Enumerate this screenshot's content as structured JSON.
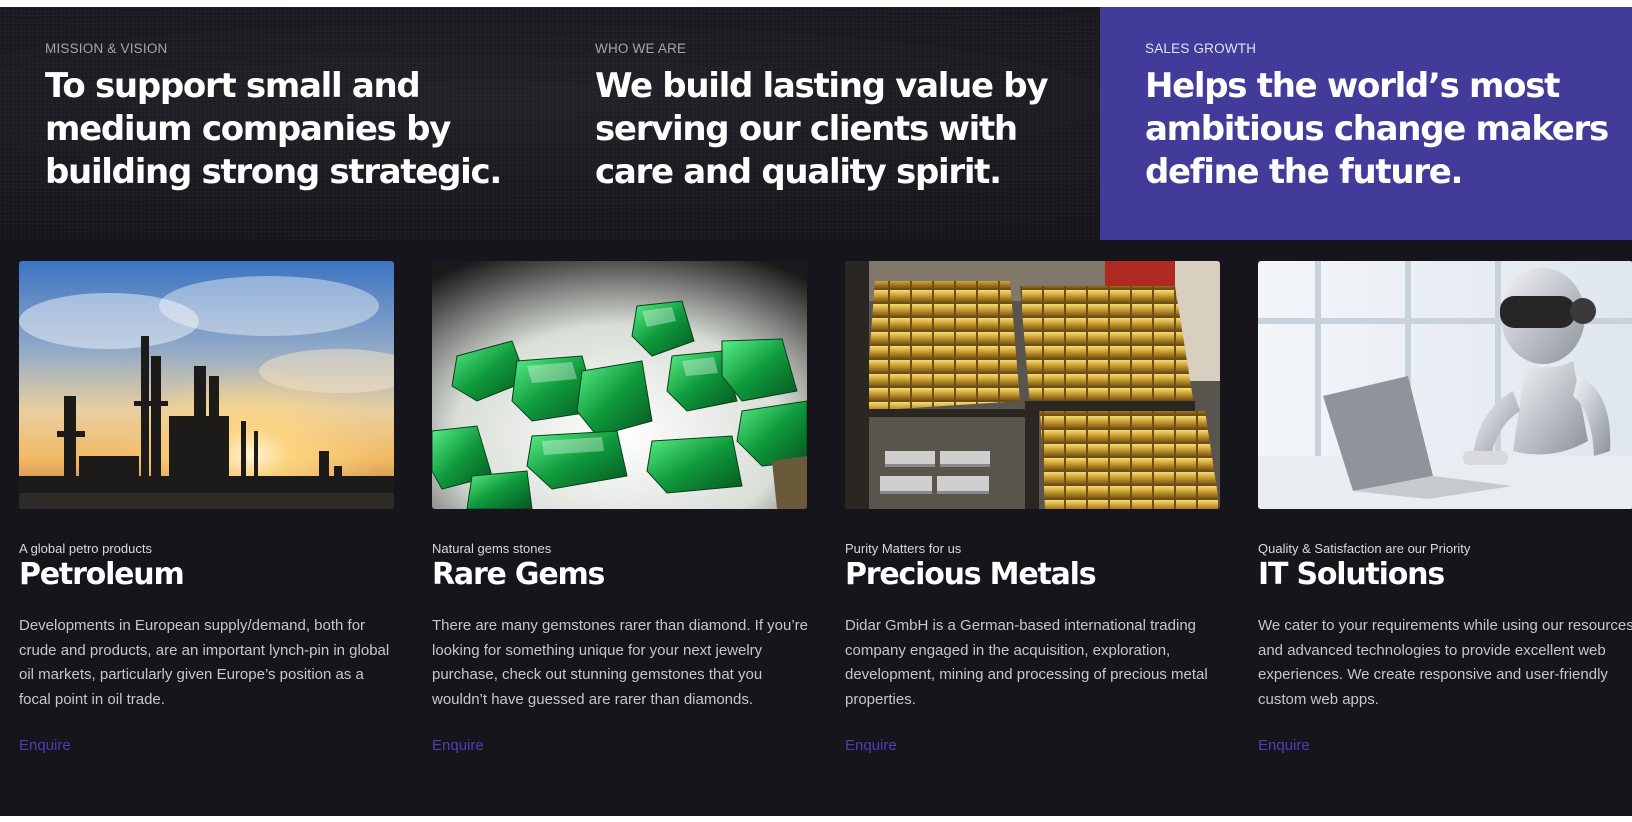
{
  "hero": [
    {
      "eyebrow": "MISSION & VISION",
      "title": "To support small and medium companies by building strong strategic."
    },
    {
      "eyebrow": "WHO WE ARE",
      "title": "We build lasting value by serving our clients with care and quality spirit."
    },
    {
      "eyebrow": "SALES GROWTH",
      "title": "Helps the world’s most ambitious change makers define the future."
    }
  ],
  "cards": [
    {
      "image": "oil-refinery-sunset-photo",
      "tagline": "A global petro products",
      "title": "Petroleum",
      "description": "Developments in European supply/demand, both for crude and products, are an important lynch-pin in global oil markets, particularly given Europe’s position as a focal point in oil trade.",
      "link": "Enquire"
    },
    {
      "image": "green-emerald-crystals-photo",
      "tagline": "Natural gems stones",
      "title": "Rare Gems",
      "description": "There are many gemstones rarer than diamond. If you’re looking for something unique for your next jewelry purchase, check out stunning gemstones that you wouldn’t have guessed are rarer than diamonds.",
      "link": "Enquire"
    },
    {
      "image": "gold-bullion-bars-vault-photo",
      "tagline": "Purity Matters for us",
      "title": "Precious Metals",
      "description": "Didar GmbH is a German-based international trading company engaged in the acquisition, exploration, development, mining and processing of precious metal properties.",
      "link": "Enquire"
    },
    {
      "image": "robot-with-laptop-photo",
      "tagline": "Quality & Satisfaction are our Priority",
      "title": "IT Solutions",
      "description": "We cater to your requirements while using our resources and advanced technologies to provide excellent web experiences. We create responsive and user-friendly custom web apps.",
      "link": "Enquire"
    }
  ],
  "colors": {
    "background": "#16151b",
    "accent_panel": "#423b9a",
    "link": "#4a40b4"
  }
}
